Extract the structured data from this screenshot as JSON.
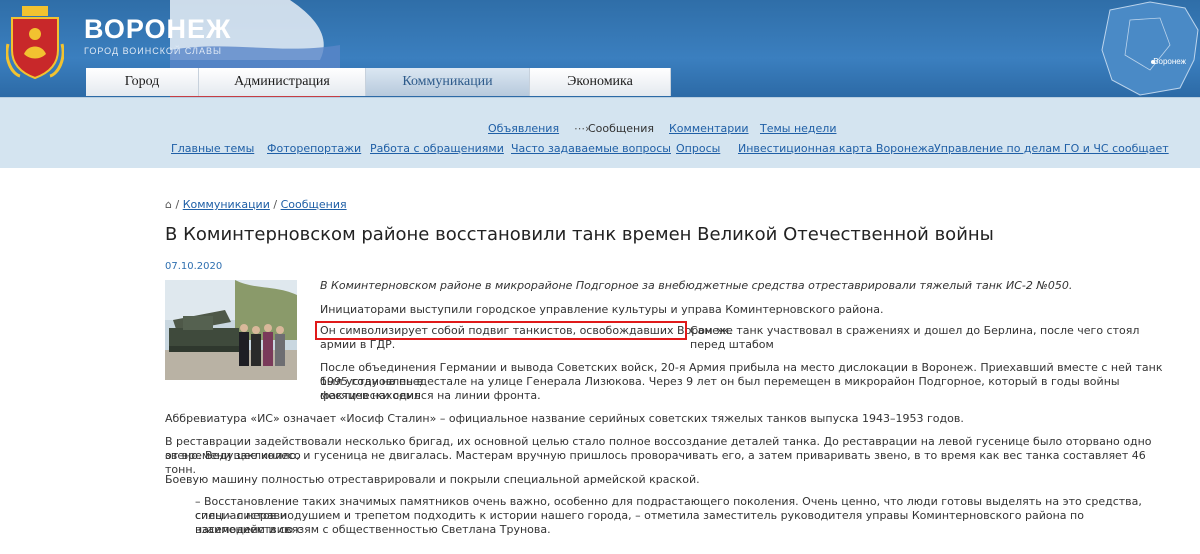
{
  "header": {
    "city_name": "ВОРОНЕЖ",
    "city_subtitle": "ГОРОД ВОИНСКОЙ СЛАВЫ",
    "map_label": "Воронеж",
    "nav": [
      "Город",
      "Администрация",
      "Коммуникации",
      "Экономика"
    ],
    "active_nav": "Коммуникации"
  },
  "subnav": {
    "row1": [
      "Объявления",
      "Сообщения",
      "Комментарии",
      "Темы недели"
    ],
    "row1_current": "Сообщения",
    "row2": [
      "Главные темы",
      "Фоторепортажи",
      "Работа с обращениями",
      "Часто задаваемые вопросы",
      "Опросы",
      "Инвестиционная карта Воронежа",
      "Управление по делам ГО и ЧС сообщает"
    ]
  },
  "breadcrumb": {
    "home_icon": "home-icon",
    "items": [
      "Коммуникации",
      "Сообщения"
    ],
    "separator": "/"
  },
  "article": {
    "title": "В Коминтерновском районе восстановили танк времен Великой Отечественной войны",
    "date": "07.10.2020",
    "lead": "В Коминтерновском районе в микрорайоне Подгорное за внебюджетные средства отреставрировали тяжелый танк ИС-2 №050.",
    "p1": "Инициаторами выступили городское управление культуры и управа Коминтерновского района.",
    "p2_highlight": "Он символизирует собой подвиг танкистов, освобождавших Воронеж.",
    "p2_rest_line1": "Сам же танк участвовал в сражениях и дошел до Берлина, после чего стоял перед штабом",
    "p2_rest_line2": "армии в ГДР.",
    "p3_line1": "После объединения Германии и вывода Советских войск, 20-я Армия прибыла на место дислокации в Воронеж. Приехавший вместе с ней танк был установлен в",
    "p3_line2": "1995 году на пьедестале на улице Генерала Лизюкова. Через 9 лет он был перемещен в микрорайон Подгорное, который в годы войны фактически семь",
    "p3_line3": "месяцев находился на линии фронта.",
    "p4": "Аббревиатура «ИС» означает «Иосиф Сталин» – официальное название серийных советских тяжелых танков выпуска 1943–1953 годов.",
    "p5_line1": "В реставрации задействовали несколько бригад, их основной целью стало полное воссоздание деталей танка. До реставрации на левой гусенице было оторвано одно звено. Ведущее колесо",
    "p5_line2": "от времени заклинило, и гусеница не двигалась. Мастерам вручную пришлось проворачивать его, а затем приваривать звено, в то время как вес танка составляет 46 тонн.",
    "p6": "Боевую машину полностью отреставрировали и покрыли специальной армейской краской.",
    "quote_line1": "– Восстановление таких значимых памятников очень важно, особенно для подрастающего поколения. Очень ценно, что люди готовы выделять на это средства, специалистов и",
    "quote_line2": "силы – с неравнодушием и трепетом подходить к истории нашего города, – отметила заместитель руководителя управы Коминтерновского района по взаимодействию с",
    "quote_line3": "населением и связям с общественностью Светлана Трунова."
  },
  "colors": {
    "header_blue": "#3b7fbf",
    "subnav_bg": "#d4e4f0",
    "link": "#1f5fa6",
    "highlight": "#e01a1a"
  }
}
